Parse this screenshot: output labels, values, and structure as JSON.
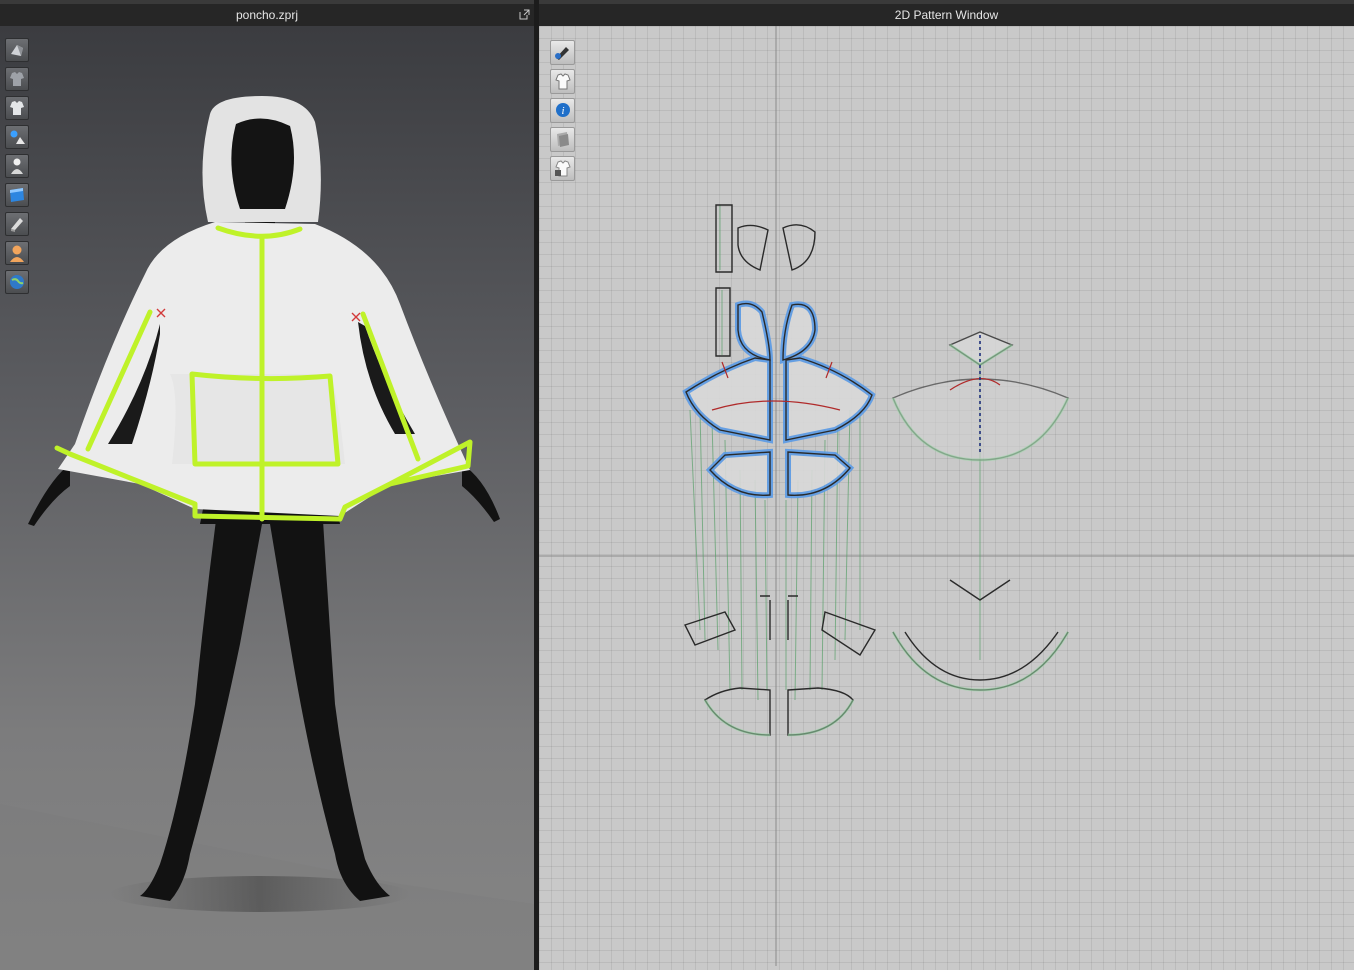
{
  "viewport3d": {
    "title": "poncho.zprj",
    "toolbar": [
      "display-avatar-icon",
      "display-garment-icon",
      "garment-shirt-icon",
      "avatar-scene-icon",
      "avatar-figure-icon",
      "fabric-texture-icon",
      "fabric-render-icon",
      "skin-avatar-icon",
      "environment-globe-icon"
    ]
  },
  "pattern2d": {
    "title": "2D Pattern Window",
    "toolbar": [
      "pattern-edit-icon",
      "show-garment-icon",
      "info-icon",
      "layer-icon",
      "lock-garment-icon"
    ]
  },
  "colors": {
    "trim": "#bff229",
    "selected_outline": "#5b9be6",
    "seam_line": "#4f9a5e",
    "pattern_bg": "#c9c9c9"
  }
}
